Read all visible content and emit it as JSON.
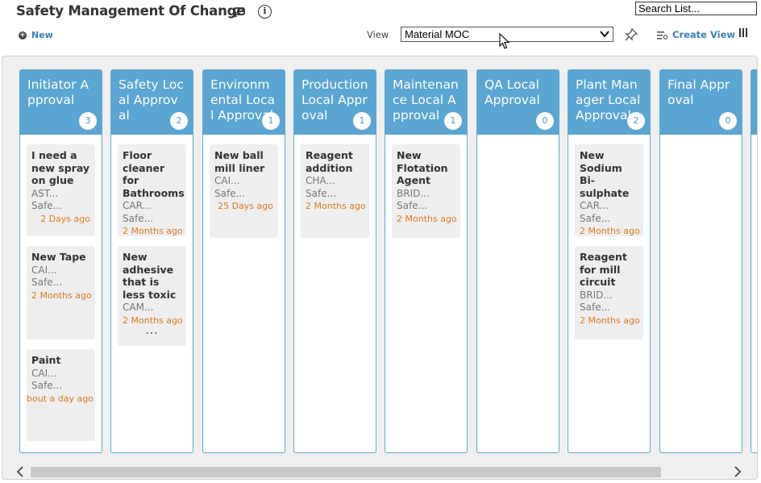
{
  "header": {
    "title": "Safety Management Of Change",
    "search_placeholder": "Search List...",
    "new_label": "New",
    "view_label": "View",
    "view_selected": "Material MOC",
    "create_view_label": "Create View"
  },
  "lanes": [
    {
      "title": "Initiator Approval",
      "count": "3",
      "cards": [
        {
          "title": "I need a new spray on glue",
          "meta1": "AST...",
          "meta2": "Safe...",
          "date": "2 Days ago"
        },
        {
          "title": "New Tape",
          "meta1": "CAI...",
          "meta2": "Safe...",
          "date": "2 Months ago"
        },
        {
          "title": "Paint",
          "meta1": "CAI...",
          "meta2": "Safe...",
          "date": "bout a day ago"
        }
      ]
    },
    {
      "title": "Safety Local Approval",
      "count": "2",
      "cards": [
        {
          "title": "Floor cleaner for Bathrooms",
          "meta1": "CAR...",
          "meta2": "Safe...",
          "date": "2 Months ago"
        },
        {
          "title": "New adhesive that is less toxic",
          "meta1": "CAM...",
          "date": "2 Months ago",
          "more": "..."
        }
      ]
    },
    {
      "title": "Environmental Local Approval",
      "count": "1",
      "cards": [
        {
          "title": "New ball mill liner",
          "meta1": "CAI...",
          "meta2": "Safe...",
          "date": "25 Days ago"
        }
      ]
    },
    {
      "title": "Production Local Approval",
      "count": "1",
      "cards": [
        {
          "title": "Reagent addition",
          "meta1": "CHA...",
          "meta2": "Safe...",
          "date": "2 Months ago"
        }
      ]
    },
    {
      "title": "Maintenance Local Approval",
      "count": "1",
      "cards": [
        {
          "title": "New Flotation Agent",
          "meta1": "BRID...",
          "meta2": "Safe...",
          "date": "2 Months ago"
        }
      ]
    },
    {
      "title": "QA Local Approval",
      "count": "0",
      "cards": []
    },
    {
      "title": "Plant Manager Local Approval",
      "count": "2",
      "cards": [
        {
          "title": "New Sodium Bi-sulphate",
          "meta1": "CAR...",
          "meta2": "Safe...",
          "date": "2 Months ago"
        },
        {
          "title": "Reagent for mill circuit",
          "meta1": "BRID...",
          "meta2": "Safe...",
          "date": "2 Months ago"
        }
      ]
    },
    {
      "title": "Final Approval",
      "count": "0",
      "cards": []
    }
  ],
  "colors": {
    "lane_header": "#5aa5d2",
    "link": "#3a7fb5",
    "date": "#e07a1f"
  }
}
